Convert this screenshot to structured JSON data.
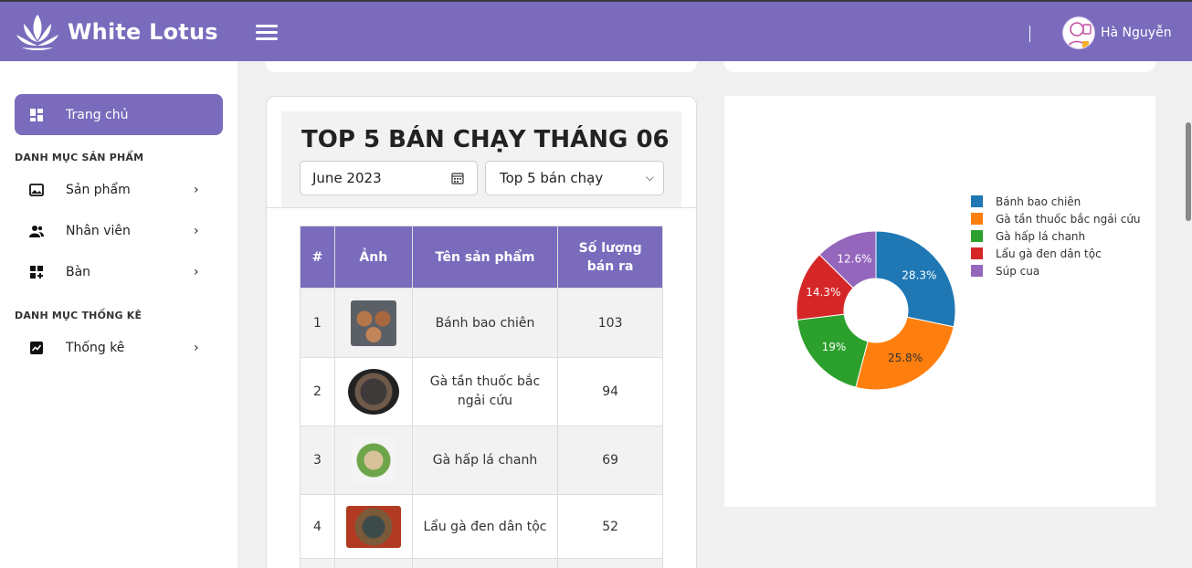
{
  "header": {
    "brand": "White Lotus",
    "user_name": "Hà Nguyễn"
  },
  "sidebar": {
    "home": "Trang chủ",
    "section_products": "DANH MỤC SẢN PHẨM",
    "section_stats": "DANH MỤC THỐNG KÊ",
    "items": [
      {
        "label": "Sản phẩm",
        "icon": "image-icon"
      },
      {
        "label": "Nhân viên",
        "icon": "users-icon"
      },
      {
        "label": "Bàn",
        "icon": "grid-add-icon"
      },
      {
        "label": "Thống kê",
        "icon": "chart-icon"
      }
    ]
  },
  "top5": {
    "title": "TOP 5 BÁN CHẠY THÁNG 06",
    "month_value": "June 2023",
    "select_value": "Top 5 bán chạy",
    "columns": [
      "#",
      "Ảnh",
      "Tên sản phẩm",
      "Số lượng bán ra"
    ],
    "rows": [
      {
        "rank": "1",
        "name": "Bánh bao chiên",
        "qty": "103"
      },
      {
        "rank": "2",
        "name": "Gà tần thuốc bắc ngải cứu",
        "qty": "94"
      },
      {
        "rank": "3",
        "name": "Gà hấp lá chanh",
        "qty": "69"
      },
      {
        "rank": "4",
        "name": "Lẩu gà đen dân tộc",
        "qty": "52"
      }
    ]
  },
  "colors": {
    "accent": "#7a6bbd"
  },
  "chart_data": {
    "type": "pie",
    "donut": true,
    "categories": [
      "Bánh bao chiên",
      "Gà tần thuốc bắc ngải cứu",
      "Gà hấp lá chanh",
      "Lẩu gà đen dân tộc",
      "Súp cua"
    ],
    "values": [
      28.3,
      25.8,
      19,
      14.3,
      12.6
    ],
    "labels": [
      "28.3%",
      "25.8%",
      "19%",
      "14.3%",
      "12.6%"
    ],
    "colors": [
      "#1f77b4",
      "#ff7f0e",
      "#2ca02c",
      "#d62728",
      "#9467bd"
    ],
    "legend_position": "right"
  }
}
